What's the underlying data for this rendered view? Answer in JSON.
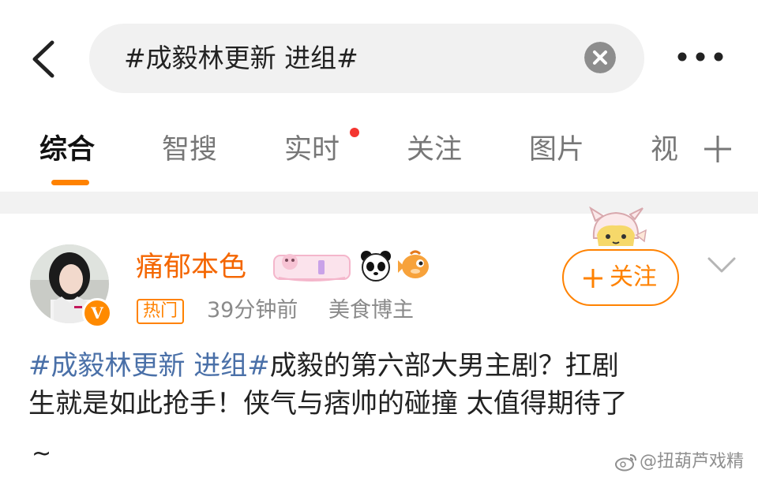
{
  "search": {
    "query": "#成毅林更新 进组#"
  },
  "tabs": [
    {
      "label": "综合",
      "active": true
    },
    {
      "label": "智搜",
      "active": false
    },
    {
      "label": "实时",
      "active": false,
      "has_dot": true
    },
    {
      "label": "关注",
      "active": false
    },
    {
      "label": "图片",
      "active": false
    },
    {
      "label": "视",
      "active": false
    }
  ],
  "post": {
    "username": "痛郁本色",
    "hot_tag": "热门",
    "time": "39分钟前",
    "role": "美食博主",
    "follow_label": "关注",
    "hashtag": "#成毅林更新 进组#",
    "body_line1": "成毅的第六部大男主剧？扛剧",
    "body_line2": "生就是如此抢手！侠气与痞帅的碰撞 太值得期待了",
    "body_line3": "~",
    "vip_badge": "V"
  },
  "watermark": {
    "text": "@扭葫芦戏精"
  },
  "colors": {
    "accent": "#ff8200",
    "username": "#f46600",
    "hashtag": "#4a70a8",
    "notification_dot": "#f43530"
  },
  "icons": [
    "back-icon",
    "clear-icon",
    "more-icon",
    "add-tab-icon",
    "chevron-down-icon",
    "weibo-logo-icon"
  ]
}
